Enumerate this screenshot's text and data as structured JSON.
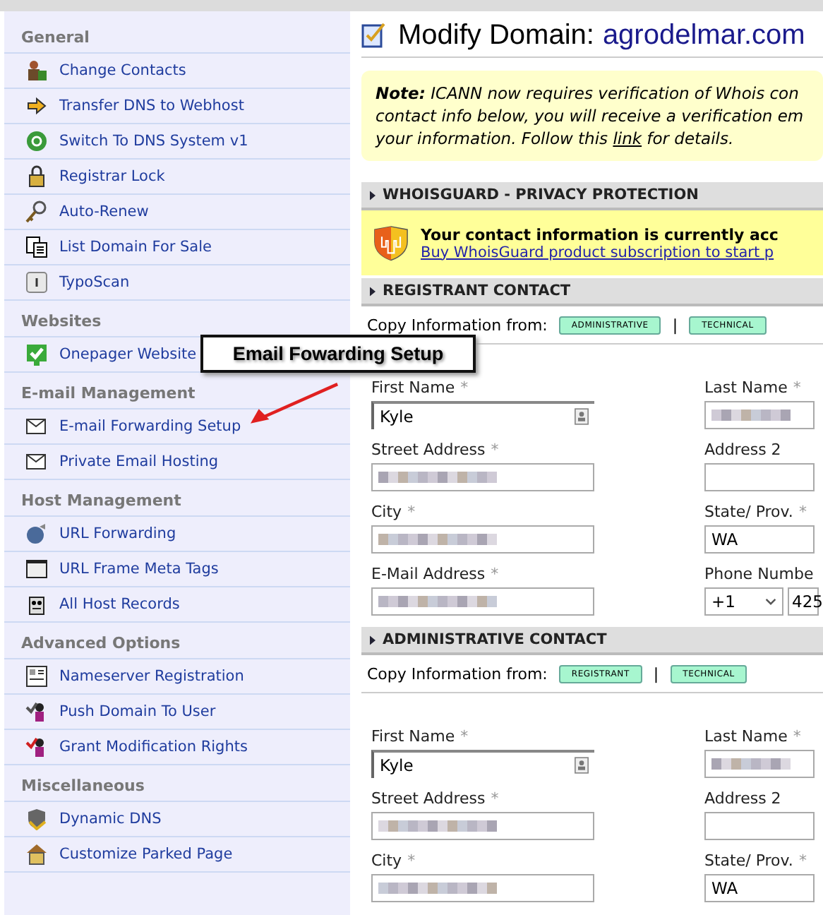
{
  "sidebar": {
    "sections": [
      {
        "title": "General",
        "items": [
          "Change Contacts",
          "Transfer DNS to Webhost",
          "Switch To DNS System v1",
          "Registrar Lock",
          "Auto-Renew",
          "List Domain For Sale",
          "TypoScan"
        ]
      },
      {
        "title": "Websites",
        "items": [
          "Onepager Website"
        ]
      },
      {
        "title": "E-mail Management",
        "items": [
          "E-mail Forwarding Setup",
          "Private Email Hosting"
        ]
      },
      {
        "title": "Host Management",
        "items": [
          "URL Forwarding",
          "URL Frame Meta Tags",
          "All Host Records"
        ]
      },
      {
        "title": "Advanced Options",
        "items": [
          "Nameserver Registration",
          "Push Domain To User",
          "Grant Modification Rights"
        ]
      },
      {
        "title": "Miscellaneous",
        "items": [
          "Dynamic DNS",
          "Customize Parked Page"
        ]
      }
    ]
  },
  "callout": {
    "text": "Email Fowarding Setup"
  },
  "header": {
    "title": "Modify Domain:",
    "domain": "agrodelmar.com"
  },
  "note": {
    "label": "Note:",
    "lines": [
      "ICANN now requires verification of Whois con",
      "contact info below, you will receive a verification em"
    ],
    "last_before": "your information. Follow this ",
    "link": "link",
    "last_after": " for details."
  },
  "whoisguard": {
    "heading": "WHOISGUARD - PRIVACY PROTECTION",
    "message": "Your contact information is currently acc",
    "link": "Buy WhoisGuard product subscription to start p"
  },
  "contacts": [
    {
      "heading": "REGISTRANT CONTACT",
      "copy_label": "Copy Information from:",
      "copy_buttons": [
        "ADMINISTRATIVE",
        "TECHNICAL"
      ],
      "separator": "|",
      "fields": [
        {
          "kind": "autofill",
          "label": "First Name",
          "mark": "*",
          "value": "Kyle"
        },
        {
          "kind": "redacted",
          "label": "Last Name",
          "mark": "*"
        },
        {
          "kind": "redacted",
          "label": "Street Address",
          "mark": "*"
        },
        {
          "kind": "text",
          "label": "Address 2"
        },
        {
          "kind": "redacted",
          "label": "City",
          "mark": "*"
        },
        {
          "kind": "select",
          "label": "State/ Prov.",
          "mark": "*",
          "value": "WA"
        },
        {
          "kind": "redacted",
          "label": "E-Mail Address",
          "mark": "*"
        },
        {
          "kind": "phone",
          "label": "Phone Numbe",
          "code": "+1",
          "value": "425"
        }
      ]
    },
    {
      "heading": "ADMINISTRATIVE CONTACT",
      "copy_label": "Copy Information from:",
      "copy_buttons": [
        "REGISTRANT",
        "TECHNICAL"
      ],
      "separator": "|",
      "fields": [
        {
          "kind": "autofill",
          "label": "First Name",
          "mark": "*",
          "value": "Kyle"
        },
        {
          "kind": "redacted",
          "label": "Last Name",
          "mark": "*"
        },
        {
          "kind": "redacted",
          "label": "Street Address",
          "mark": "*"
        },
        {
          "kind": "text",
          "label": "Address 2"
        },
        {
          "kind": "redacted",
          "label": "City",
          "mark": "*"
        },
        {
          "kind": "select",
          "label": "State/ Prov.",
          "mark": "*",
          "value": "WA"
        }
      ]
    }
  ]
}
